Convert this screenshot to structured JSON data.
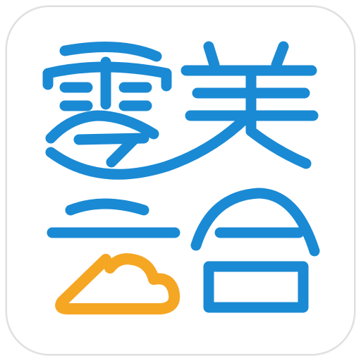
{
  "app": {
    "name_line1": "零美",
    "name_line2": "云合",
    "accessible_name": "零美云合"
  },
  "colors": {
    "brand_blue": "#1a8ad4",
    "brand_orange": "#f5a623",
    "background": "#ffffff",
    "border": "#dedede"
  },
  "icons": {
    "logo": "ling-mei-yun-he-logo",
    "cloud": "cloud-icon"
  }
}
